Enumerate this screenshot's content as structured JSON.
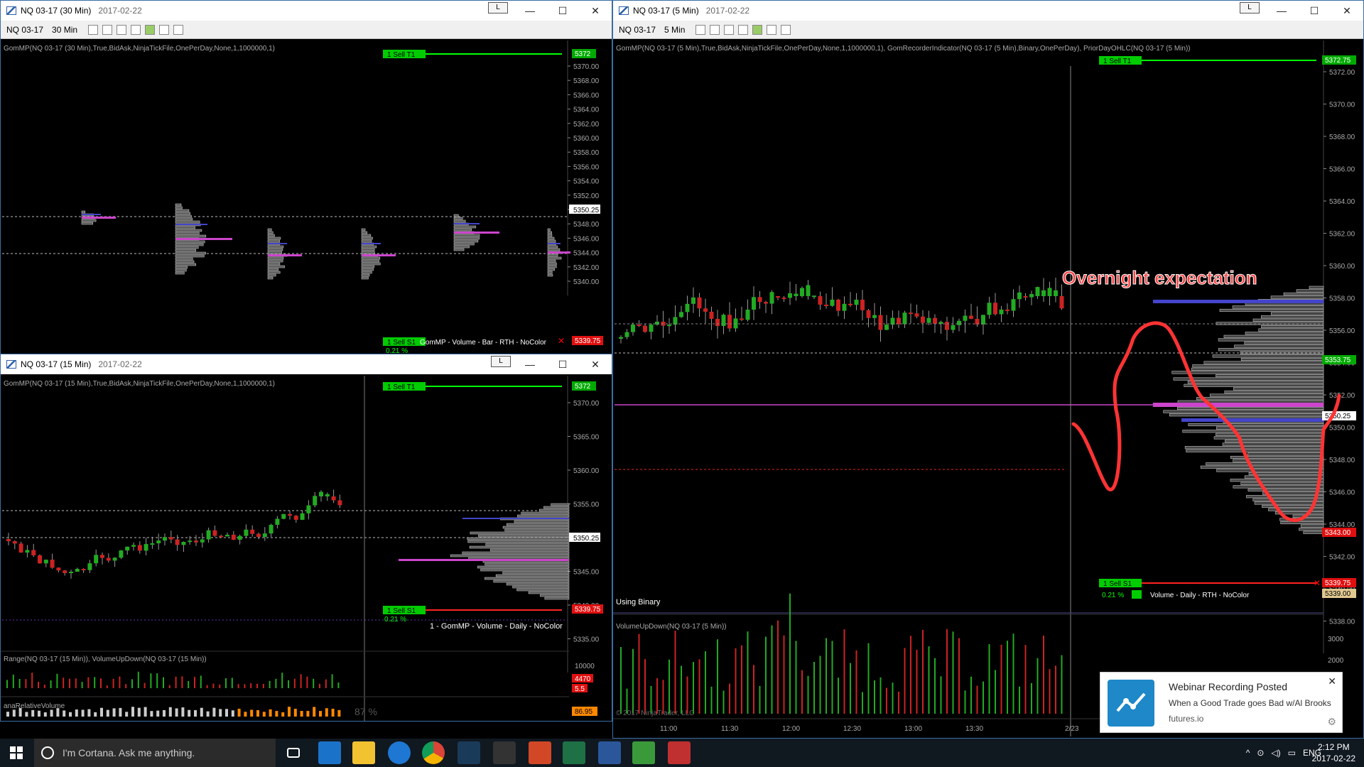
{
  "windows": {
    "w30": {
      "title": "NQ 03-17 (30 Min)",
      "date": "2017-02-22",
      "instrument": "NQ 03-17",
      "period": "30 Min",
      "indicator": "GomMP(NQ 03-17 (30 Min),True,BidAsk,NinjaTickFile,OnePerDay,None,1,1000000,1)",
      "sell_t1": "1  Sell T1",
      "sell_t1_price": "5372",
      "sell_s1": "1  Sell S1",
      "sell_s1_pct": "0.21 %",
      "sell_s1_price": "5339.75",
      "profile_label": "GomMP - Volume - Bar - RTH - NoColor",
      "last_price": "5350.25",
      "ticks": [
        "5370.00",
        "5368.00",
        "5366.00",
        "5364.00",
        "5362.00",
        "5360.00",
        "5358.00",
        "5356.00",
        "5354.00",
        "5352.00",
        "5350.25",
        "5348.00",
        "5346.00",
        "5344.00",
        "5342.00",
        "5340.00"
      ]
    },
    "w15": {
      "title": "NQ 03-17 (15 Min)",
      "date": "2017-02-22",
      "indicator": "GomMP(NQ 03-17 (15 Min),True,BidAsk,NinjaTickFile,OnePerDay,None,1,1000000,1)",
      "sell_t1": "1  Sell T1",
      "sell_t1_price": "5372",
      "sell_s1": "1  Sell S1",
      "sell_s1_pct": "0.21 %",
      "sell_s1_price": "5339.75",
      "profile_label": "1 - GomMP - Volume - Daily - NoColor",
      "last_price": "5350.25",
      "ticks": [
        "5370.00",
        "5365.00",
        "5360.00",
        "5355.00",
        "5350.25",
        "5345.00",
        "5340.00",
        "5335.00"
      ],
      "panel2_label": "Range(NQ 03-17 (15 Min)), VolumeUpDown(NQ 03-17 (15 Min))",
      "panel2_vals": [
        "10000",
        "4470",
        "5.5"
      ],
      "panel3_label": "anaRelativeVolume",
      "panel3_pct": "87 %",
      "panel3_val": "86.95"
    },
    "w5": {
      "title": "NQ 03-17 (5 Min)",
      "date": "2017-02-22",
      "instrument": "NQ 03-17",
      "period": "5 Min",
      "indicator": "GomMP(NQ 03-17 (5 Min),True,BidAsk,NinjaTickFile,OnePerDay,None,1,1000000,1), GomRecorderIndicator(NQ 03-17 (5 Min),Binary,OnePerDay), PriorDayOHLC(NQ 03-17 (5 Min))",
      "sell_t1": "1  Sell T1",
      "sell_t1_price": "5372.75",
      "sell_s1": "1  Sell S1",
      "sell_s1_pct": "0.21 %",
      "sell_s1_price": "5339.75",
      "profile_label": "Volume - Daily - RTH - NoColor",
      "annotation": "Overnight expectation",
      "using": "Using Binary",
      "vol_label": "VolumeUpDown(NQ 03-17 (5 Min))",
      "copyright": "© 2017 NinjaTrader, LLC",
      "price_tags": [
        "5353.75",
        "5350.25",
        "5343.00",
        "5339.00"
      ],
      "ticks": [
        "5372.00",
        "5370.00",
        "5368.00",
        "5366.00",
        "5364.00",
        "5362.00",
        "5360.00",
        "5358.00",
        "5356.00",
        "5354.00",
        "5352.00",
        "5350.00",
        "5348.00",
        "5346.00",
        "5344.00",
        "5342.00",
        "5340.00",
        "5338.00"
      ],
      "vol_ticks": [
        "3000",
        "2000"
      ],
      "times": [
        "11:00",
        "11:30",
        "12:00",
        "12:30",
        "13:00",
        "13:30",
        "2/23"
      ]
    }
  },
  "toast": {
    "title": "Webinar Recording Posted",
    "body": "When a Good Trade goes Bad w/Al Brooks",
    "source": "futures.io"
  },
  "taskbar": {
    "cortana": "I'm Cortana. Ask me anything.",
    "lang": "ENG",
    "time": "2:12 PM",
    "date": "2017-02-22"
  },
  "colors": {
    "up": "#22aa22",
    "down": "#cc2222",
    "sell_t1": "#00ff00",
    "sell_s1": "#ff2222",
    "profile_poc": "#cc44cc",
    "profile_va": "#4444cc",
    "annotation": "#ff3333"
  }
}
